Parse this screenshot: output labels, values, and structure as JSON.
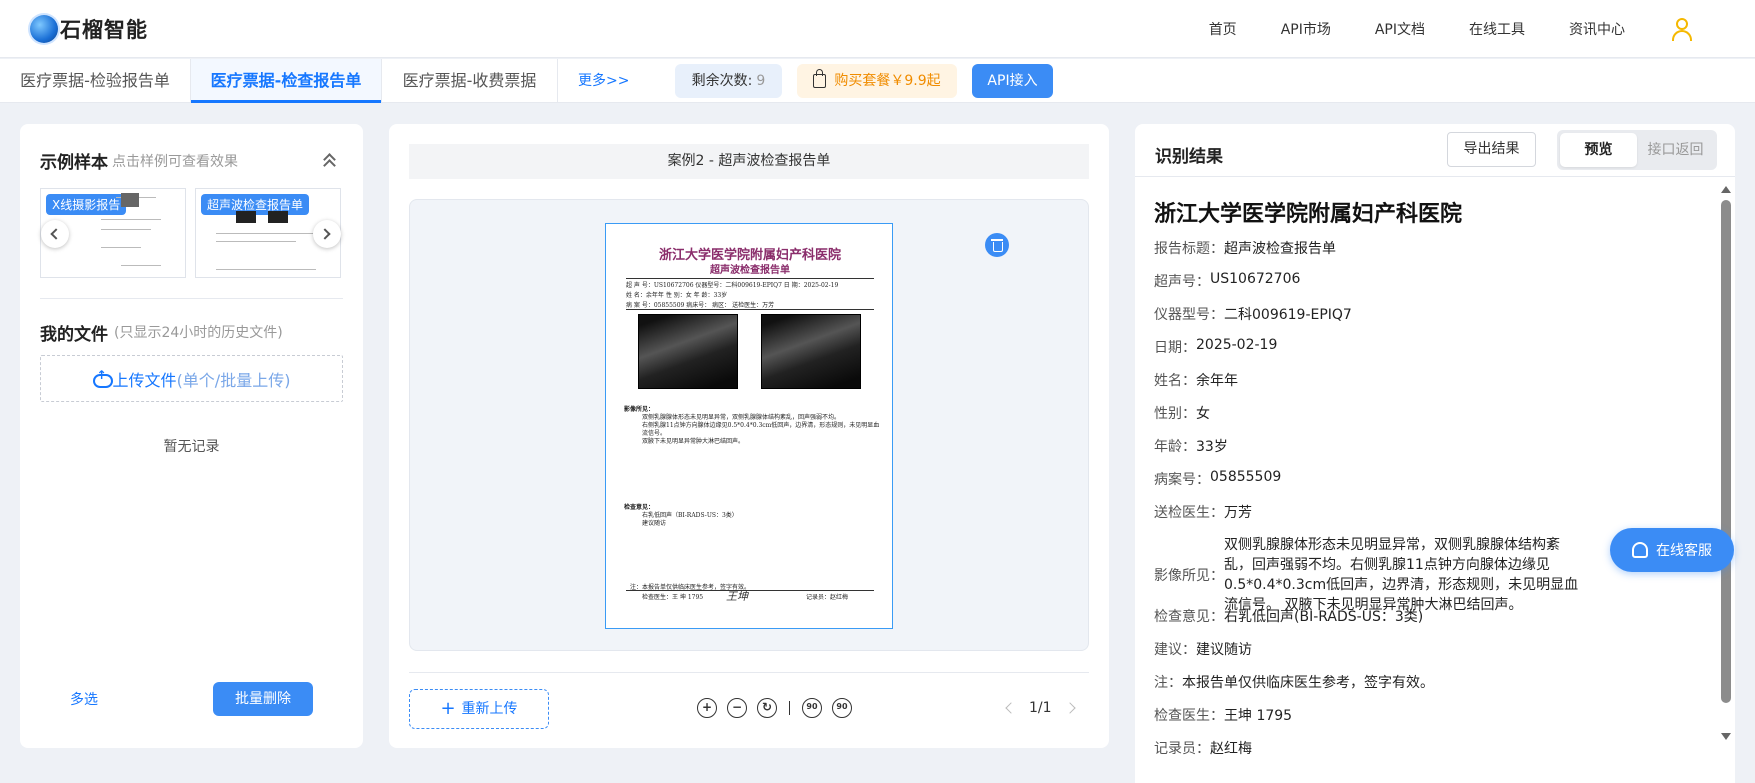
{
  "brand": {
    "name": "石榴智能"
  },
  "nav": {
    "items": [
      "首页",
      "API市场",
      "API文档",
      "在线工具",
      "资讯中心"
    ]
  },
  "tabs": {
    "items": [
      "医疗票据-检验报告单",
      "医疗票据-检查报告单",
      "医疗票据-收费票据"
    ],
    "more": "更多>>",
    "remaining_label": "剩余次数:",
    "remaining_value": "9",
    "buy_label": "购买套餐￥9.9起",
    "api_label": "API接入"
  },
  "left": {
    "samples_title": "示例样本",
    "samples_hint": "点击样例可查看效果",
    "samples": [
      {
        "badge": "X线摄影报告"
      },
      {
        "badge": "超声波检查报告单"
      }
    ],
    "files_title": "我的文件",
    "files_hint": "(只显示24小时的历史文件)",
    "upload_main": "上传文件",
    "upload_sub": "(单个/批量上传)",
    "empty": "暂无记录",
    "multi_select": "多选",
    "bulk_delete": "批量删除"
  },
  "middle": {
    "case_title": "案例2 - 超声波检查报告单",
    "doc": {
      "hospital": "浙江大学医学院附属妇产科医院",
      "subtitle": "超声波检查报告单",
      "row1": "超 声 号：US10672706    仪器型号：二科009619-EPIQ7    日  期：2025-02-19",
      "row2": "姓    名：余年年          性    别：女               年  龄：33岁",
      "row3": "病 案 号：05855509    病床号：    病区：    送检医生：万芳",
      "findings_label": "影像所见：",
      "findings_1": "双侧乳腺腺体形态未见明显异常，双侧乳腺腺体结构紊乱，回声强弱不均。",
      "findings_2": "右侧乳腺11点钟方向腺体边缘见0.5*0.4*0.3cm低回声，边界清，形态规则，未见明显血",
      "findings_3": "流信号。",
      "findings_4": "双腋下未见明显异常肿大淋巴结回声。",
      "opinion_label": "检查意见：",
      "opinion_1": "右乳低回声（BI-RADS-US：3类）",
      "opinion_2": "建议随访",
      "note": "注：本报告单仅供临床医生参考，签字有效。",
      "doctor": "检查医生：王  坤  1795",
      "recorder": "记录员：赵红梅",
      "signature": "王坤"
    },
    "reupload": "重新上传",
    "tools": [
      "+",
      "−",
      "↻",
      "90",
      "90"
    ],
    "page": "1/1"
  },
  "right": {
    "title": "识别结果",
    "export": "导出结果",
    "toggle_on": "预览",
    "toggle_off": "接口返回",
    "hospital": "浙江大学医学院附属妇产科医院",
    "fields": [
      {
        "k": "报告标题：",
        "v": "超声波检查报告单"
      },
      {
        "k": "超声号：",
        "v": "US10672706"
      },
      {
        "k": "仪器型号：",
        "v": "二科009619-EPIQ7"
      },
      {
        "k": "日期：",
        "v": "2025-02-19"
      },
      {
        "k": "姓名：",
        "v": "余年年"
      },
      {
        "k": "性别：",
        "v": "女"
      },
      {
        "k": "年龄：",
        "v": "33岁"
      },
      {
        "k": "病案号：",
        "v": "05855509"
      },
      {
        "k": "送检医生：",
        "v": "万芳"
      },
      {
        "k": "影像所见：",
        "v": "双侧乳腺腺体形态未见明显异常，双侧乳腺腺体结构紊乱，回声强弱不均。右侧乳腺11点钟方向腺体边缘见0.5*0.4*0.3cm低回声，边界清，形态规则，未见明显血流信号。 双腋下未见明显异常肿大淋巴结回声。"
      },
      {
        "k": "检查意见：",
        "v": "右乳低回声(BI-RADS-US：3类)"
      },
      {
        "k": "建议：",
        "v": "建议随访"
      },
      {
        "k": "注：",
        "v": "本报告单仅供临床医生参考，签字有效。"
      },
      {
        "k": "检查医生：",
        "v": "王坤 1795"
      },
      {
        "k": "记录员：",
        "v": "赵红梅"
      }
    ]
  },
  "chat": {
    "label": "在线客服"
  }
}
